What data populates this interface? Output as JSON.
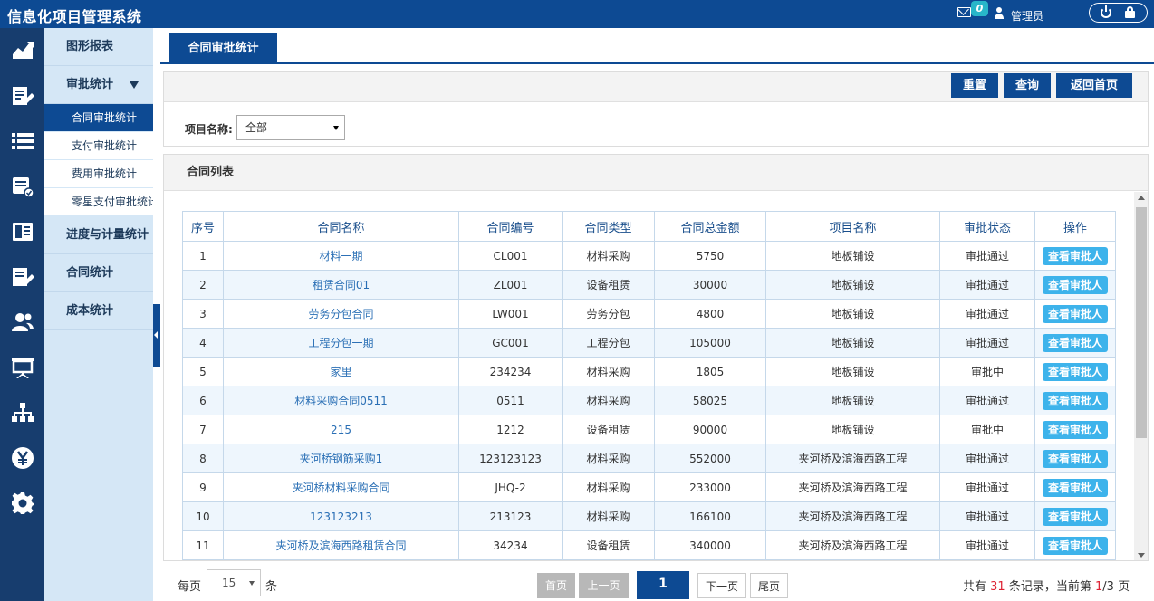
{
  "header": {
    "app_title": "信息化项目管理系统",
    "mail_count": "0",
    "user_name": "管理员"
  },
  "rail": {
    "icons": [
      "chart-icon",
      "edit-doc-icon",
      "list-icon",
      "approve-doc-icon",
      "book-icon",
      "edit-doc-icon",
      "users-icon",
      "presentation-icon",
      "org-chart-icon",
      "yen-icon",
      "gear-icon"
    ],
    "active_index": 0
  },
  "sidebar": {
    "groups": [
      {
        "label": "图形报表"
      },
      {
        "label": "审批统计"
      },
      {
        "label": "进度与计量统计"
      },
      {
        "label": "合同统计"
      },
      {
        "label": "成本统计"
      }
    ],
    "approval_subitems": [
      "合同审批统计",
      "支付审批统计",
      "费用审批统计",
      "零星支付审批统计"
    ],
    "active_subitem": "合同审批统计"
  },
  "tabs": [
    {
      "label": "合同审批统计"
    }
  ],
  "toolbar": {
    "reset_label": "重置",
    "query_label": "查询",
    "home_label": "返回首页"
  },
  "filter": {
    "project_label": "项目名称:",
    "project_value": "全部"
  },
  "list": {
    "title": "合同列表",
    "columns": [
      "序号",
      "合同名称",
      "合同编号",
      "合同类型",
      "合同总金额",
      "项目名称",
      "审批状态",
      "操作"
    ],
    "action_label": "查看审批人",
    "rows": [
      {
        "no": "1",
        "name": "材料一期",
        "code": "CL001",
        "type": "材料采购",
        "amount": "5750",
        "project": "地板铺设",
        "status": "审批通过"
      },
      {
        "no": "2",
        "name": "租赁合同01",
        "code": "ZL001",
        "type": "设备租赁",
        "amount": "30000",
        "project": "地板铺设",
        "status": "审批通过"
      },
      {
        "no": "3",
        "name": "劳务分包合同",
        "code": "LW001",
        "type": "劳务分包",
        "amount": "4800",
        "project": "地板铺设",
        "status": "审批通过"
      },
      {
        "no": "4",
        "name": "工程分包一期",
        "code": "GC001",
        "type": "工程分包",
        "amount": "105000",
        "project": "地板铺设",
        "status": "审批通过"
      },
      {
        "no": "5",
        "name": "家里",
        "code": "234234",
        "type": "材料采购",
        "amount": "1805",
        "project": "地板铺设",
        "status": "审批中"
      },
      {
        "no": "6",
        "name": "材料采购合同0511",
        "code": "0511",
        "type": "材料采购",
        "amount": "58025",
        "project": "地板铺设",
        "status": "审批通过"
      },
      {
        "no": "7",
        "name": "215",
        "code": "1212",
        "type": "设备租赁",
        "amount": "90000",
        "project": "地板铺设",
        "status": "审批中"
      },
      {
        "no": "8",
        "name": "夹河桥钢筋采购1",
        "code": "123123123",
        "type": "材料采购",
        "amount": "552000",
        "project": "夹河桥及滨海西路工程",
        "status": "审批通过"
      },
      {
        "no": "9",
        "name": "夹河桥材料采购合同",
        "code": "JHQ-2",
        "type": "材料采购",
        "amount": "233000",
        "project": "夹河桥及滨海西路工程",
        "status": "审批通过"
      },
      {
        "no": "10",
        "name": "123123213",
        "code": "213123",
        "type": "材料采购",
        "amount": "166100",
        "project": "夹河桥及滨海西路工程",
        "status": "审批通过"
      },
      {
        "no": "11",
        "name": "夹河桥及滨海西路租赁合同",
        "code": "34234",
        "type": "设备租赁",
        "amount": "340000",
        "project": "夹河桥及滨海西路工程",
        "status": "审批通过"
      }
    ]
  },
  "pager": {
    "per_page_label": "每页",
    "per_page_value": "15",
    "per_page_unit": "条",
    "first_label": "首页",
    "prev_label": "上一页",
    "current_page": "1",
    "next_label": "下一页",
    "last_label": "尾页",
    "summary_prefix": "共有",
    "total_records": "31",
    "summary_middle": "条记录，当前第",
    "page_index": "1",
    "page_sep": "/3 页"
  },
  "colors": {
    "primary": "#0d4a93",
    "rail_bg": "#173d6e",
    "sidebar_bg": "#d5e7f6",
    "action_button": "#3db3eb",
    "link": "#2a6fb5",
    "count_highlight": "#dd2233"
  }
}
